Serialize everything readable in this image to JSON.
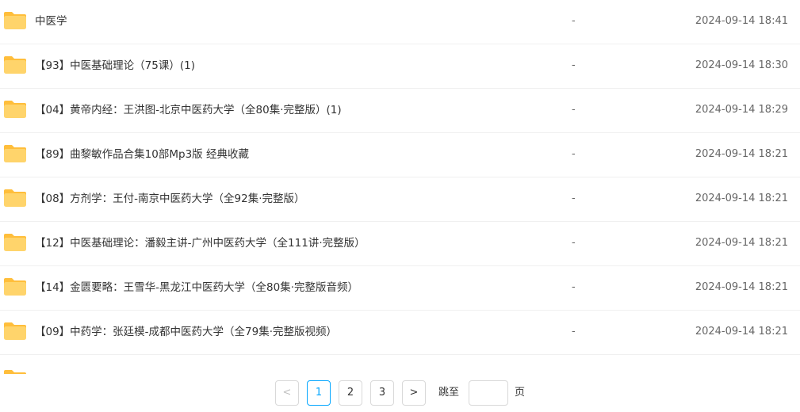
{
  "colors": {
    "folder_body": "#FFD46B",
    "folder_tab": "#FFBE3B",
    "accent": "#06A7FF"
  },
  "files": [
    {
      "icon": "folder-icon",
      "name": "中医学",
      "size": "-",
      "modified": "2024-09-14 18:41"
    },
    {
      "icon": "folder-icon",
      "name": "【93】中医基础理论（75课）(1)",
      "size": "-",
      "modified": "2024-09-14 18:30"
    },
    {
      "icon": "folder-icon",
      "name": "【04】黄帝内经：王洪图-北京中医药大学（全80集·完整版）(1)",
      "size": "-",
      "modified": "2024-09-14 18:29"
    },
    {
      "icon": "folder-icon",
      "name": "【89】曲黎敏作品合集10部Mp3版 经典收藏",
      "size": "-",
      "modified": "2024-09-14 18:21"
    },
    {
      "icon": "folder-icon",
      "name": "【08】方剂学：王付-南京中医药大学（全92集·完整版）",
      "size": "-",
      "modified": "2024-09-14 18:21"
    },
    {
      "icon": "folder-icon",
      "name": "【12】中医基础理论：潘毅主讲-广州中医药大学（全111讲·完整版）",
      "size": "-",
      "modified": "2024-09-14 18:21"
    },
    {
      "icon": "folder-icon",
      "name": "【14】金匮要略：王雪华-黑龙江中医药大学（全80集·完整版音频）",
      "size": "-",
      "modified": "2024-09-14 18:21"
    },
    {
      "icon": "folder-icon",
      "name": "【09】中药学：张廷模-成都中医药大学（全79集·完整版视频）",
      "size": "-",
      "modified": "2024-09-14 18:21"
    }
  ],
  "pagination": {
    "prev_icon": "chevron-left-icon",
    "next_icon": "chevron-right-icon",
    "prev": "<",
    "next": ">",
    "pages": [
      "1",
      "2",
      "3"
    ],
    "current_page": "1",
    "jump_label": "跳至",
    "jump_value": "",
    "page_suffix": "页"
  }
}
